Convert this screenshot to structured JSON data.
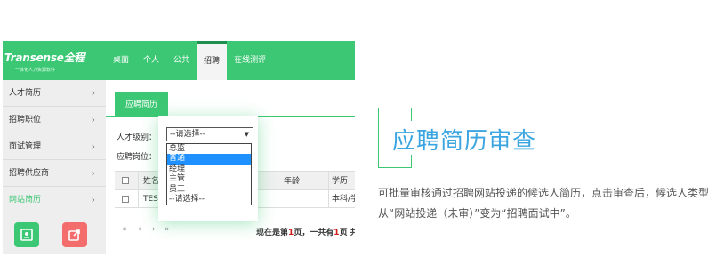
{
  "app": {
    "logo": {
      "name": "Transense全程",
      "tagline": "一体化人力资源软件"
    },
    "nav": [
      "桌面",
      "个人",
      "公共",
      "招聘",
      "在线测评"
    ],
    "nav_active": "招聘"
  },
  "sidebar": {
    "items": [
      {
        "label": "人才简历",
        "arrow": "›"
      },
      {
        "label": "招聘职位",
        "arrow": "›"
      },
      {
        "label": "面试管理",
        "arrow": "›"
      },
      {
        "label": "招聘供应商",
        "arrow": "›"
      },
      {
        "label": "网站简历",
        "arrow": "›",
        "active": true
      }
    ],
    "icons": [
      "contact-card-icon",
      "share-export-icon"
    ]
  },
  "main": {
    "tab": "应聘简历",
    "level_label": "人才级别：",
    "level_value": "--请选择--",
    "position_label": "应聘岗位：",
    "dropdown_options": [
      "总监",
      "普通",
      "经理",
      "主管",
      "员工",
      "--请选择--"
    ],
    "dropdown_highlight": "普通",
    "table": {
      "headers": [
        "姓名",
        "年龄",
        "学历"
      ],
      "rows": [
        {
          "name": "TEST",
          "age": "",
          "edu": "本科/学"
        }
      ]
    },
    "pager": {
      "buttons": [
        "«",
        "‹",
        "›",
        "»"
      ],
      "status_prefix": "现在是第",
      "current": "1",
      "status_mid": "页，一共有",
      "total": "1",
      "status_suffix": "页 共有"
    }
  },
  "hero": {
    "title": "应聘简历审查",
    "description": "可批量审核通过招聘网站投递的候选人简历，点击审查后，候选人类型从“网站投递（未审）”变为“招聘面试中”。"
  },
  "colors": {
    "brand_green": "#3cc774",
    "title_blue": "#3aa5e0",
    "accent_red": "#f36d6d"
  }
}
